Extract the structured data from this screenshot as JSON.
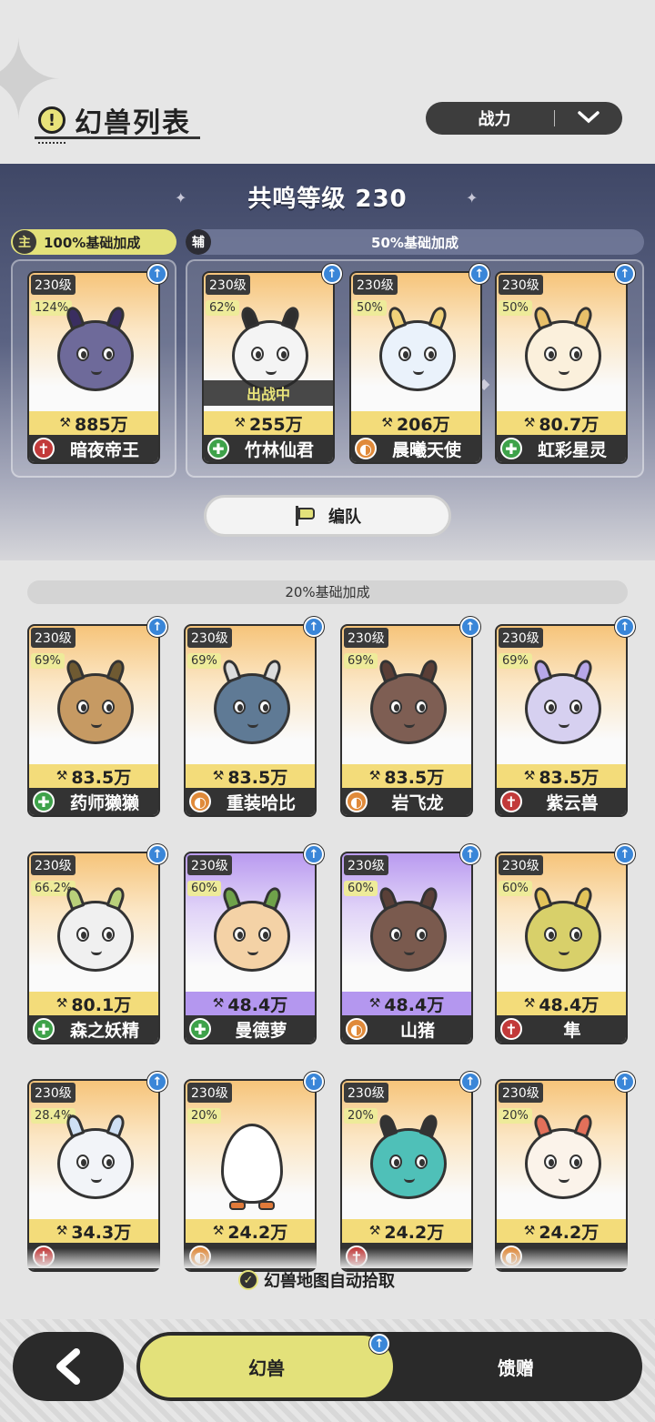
{
  "header": {
    "title": "幻兽列表",
    "sort_label": "战力"
  },
  "team": {
    "resonance_label": "共鸣等级 230",
    "main_badge": "主",
    "main_bonus": "100%基础加成",
    "sub_badge": "辅",
    "sub_bonus": "50%基础加成",
    "formation_label": "编队",
    "cards": [
      {
        "level": "230级",
        "pct": "124%",
        "power": "885万",
        "name": "暗夜帝王",
        "role": "atk",
        "theme": "orange",
        "art": "dark-dragon"
      },
      {
        "level": "230级",
        "pct": "62%",
        "power": "255万",
        "name": "竹林仙君",
        "role": "heal",
        "theme": "orange",
        "art": "panda",
        "status": "出战中"
      },
      {
        "level": "230级",
        "pct": "50%",
        "power": "206万",
        "name": "晨曦天使",
        "role": "tank",
        "theme": "orange",
        "art": "angel-dragon"
      },
      {
        "level": "230级",
        "pct": "50%",
        "power": "80.7万",
        "name": "虹彩星灵",
        "role": "heal",
        "theme": "orange",
        "art": "star-fox"
      }
    ]
  },
  "reserve": {
    "bonus_label": "20%基础加成",
    "cards": [
      {
        "level": "230级",
        "pct": "69%",
        "power": "83.5万",
        "name": "药师獭獭",
        "role": "heal",
        "theme": "orange",
        "art": "otter"
      },
      {
        "level": "230级",
        "pct": "69%",
        "power": "83.5万",
        "name": "重装哈比",
        "role": "tank",
        "theme": "orange",
        "art": "knight"
      },
      {
        "level": "230级",
        "pct": "69%",
        "power": "83.5万",
        "name": "岩飞龙",
        "role": "tank",
        "theme": "orange",
        "art": "wyvern"
      },
      {
        "level": "230级",
        "pct": "69%",
        "power": "83.5万",
        "name": "紫云兽",
        "role": "atk",
        "theme": "orange",
        "art": "cloud-beast"
      },
      {
        "level": "230级",
        "pct": "66.2%",
        "power": "80.1万",
        "name": "森之妖精",
        "role": "heal",
        "theme": "orange",
        "art": "fairy"
      },
      {
        "level": "230级",
        "pct": "60%",
        "power": "48.4万",
        "name": "曼德萝",
        "role": "heal",
        "theme": "purple",
        "art": "mandrake"
      },
      {
        "level": "230级",
        "pct": "60%",
        "power": "48.4万",
        "name": "山猪",
        "role": "tank",
        "theme": "purple",
        "art": "boar"
      },
      {
        "level": "230级",
        "pct": "60%",
        "power": "48.4万",
        "name": "隼",
        "role": "atk",
        "theme": "orange",
        "art": "bird"
      },
      {
        "level": "230级",
        "pct": "28.4%",
        "power": "34.3万",
        "name": "",
        "role": "atk",
        "theme": "orange",
        "art": "yeti"
      },
      {
        "level": "230级",
        "pct": "20%",
        "power": "24.2万",
        "name": "",
        "role": "tank",
        "theme": "orange",
        "art": "egg"
      },
      {
        "level": "230级",
        "pct": "20%",
        "power": "24.2万",
        "name": "",
        "role": "atk",
        "theme": "orange",
        "art": "blue-chick"
      },
      {
        "level": "230级",
        "pct": "20%",
        "power": "24.2万",
        "name": "",
        "role": "tank",
        "theme": "orange",
        "art": "lion-cub"
      }
    ],
    "auto_pickup": "幻兽地图自动拾取"
  },
  "bottom_nav": {
    "back_icon": "back-arrow-icon",
    "tab_beasts": "幻兽",
    "tab_gift": "馈赠"
  },
  "colors": {
    "accent": "#e3e17a",
    "dark": "#2a2a2a",
    "upgrade": "#3a86d8"
  }
}
